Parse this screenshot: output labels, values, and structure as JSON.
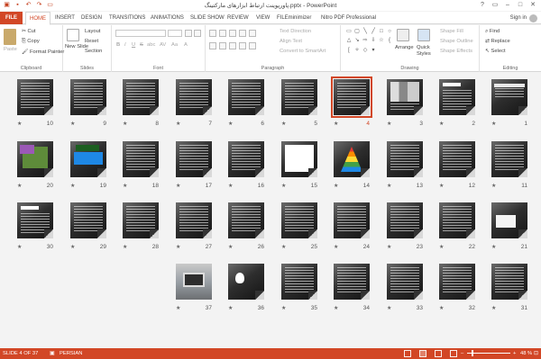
{
  "window": {
    "title": "پاورپوینت ارتباط ابزارهای مارکتینگ.pptx - PowerPoint",
    "qat_icons": [
      "save-icon",
      "undo-icon",
      "redo-icon",
      "start-presentation-icon"
    ],
    "controls": [
      "?",
      "▭",
      "–",
      "□",
      "✕"
    ]
  },
  "ribbon_tabs": [
    "FILE",
    "HOME",
    "INSERT",
    "DESIGN",
    "TRANSITIONS",
    "ANIMATIONS",
    "SLIDE SHOW",
    "REVIEW",
    "VIEW",
    "FILEminimizer",
    "Nitro PDF Professional"
  ],
  "active_tab": "HOME",
  "sign_in": "Sign in",
  "clipboard": {
    "paste": "Paste",
    "cut": "Cut",
    "copy": "Copy",
    "format_painter": "Format Painter",
    "label": "Clipboard"
  },
  "slides_group": {
    "new_slide": "New Slide",
    "layout": "Layout",
    "reset": "Reset",
    "section": "Section",
    "label": "Slides"
  },
  "font_group": {
    "label": "Font",
    "bold": "B",
    "italic": "I",
    "underline": "U",
    "strike": "S",
    "shadow": "abc",
    "spacing": "AV",
    "case": "Aa",
    "color": "A"
  },
  "paragraph_group": {
    "text_direction": "Text Direction",
    "align_text": "Align Text",
    "smartart": "Convert to SmartArt",
    "label": "Paragraph"
  },
  "drawing_group": {
    "arrange": "Arrange",
    "quick_styles": "Quick Styles",
    "shape_fill": "Shape Fill",
    "shape_outline": "Shape Outline",
    "shape_effects": "Shape Effects",
    "label": "Drawing"
  },
  "editing_group": {
    "find": "Find",
    "replace": "Replace",
    "select": "Select",
    "label": "Editing"
  },
  "slides": [
    {
      "n": "1",
      "v": "title"
    },
    {
      "n": "2",
      "v": "banner"
    },
    {
      "n": "3",
      "v": "people"
    },
    {
      "n": "4",
      "v": "text",
      "selected": true
    },
    {
      "n": "5",
      "v": "text"
    },
    {
      "n": "6",
      "v": "text"
    },
    {
      "n": "7",
      "v": "text"
    },
    {
      "n": "8",
      "v": "text"
    },
    {
      "n": "9",
      "v": "text"
    },
    {
      "n": "10",
      "v": "text"
    },
    {
      "n": "11",
      "v": "text"
    },
    {
      "n": "12",
      "v": "text"
    },
    {
      "n": "13",
      "v": "text"
    },
    {
      "n": "14",
      "v": "pyr"
    },
    {
      "n": "15",
      "v": "chart"
    },
    {
      "n": "16",
      "v": "text"
    },
    {
      "n": "17",
      "v": "text"
    },
    {
      "n": "18",
      "v": "text"
    },
    {
      "n": "19",
      "v": "vid"
    },
    {
      "n": "20",
      "v": "boxes"
    },
    {
      "n": "21",
      "v": "white"
    },
    {
      "n": "22",
      "v": "text"
    },
    {
      "n": "23",
      "v": "text"
    },
    {
      "n": "24",
      "v": "text"
    },
    {
      "n": "25",
      "v": "text"
    },
    {
      "n": "26",
      "v": "text"
    },
    {
      "n": "27",
      "v": "text"
    },
    {
      "n": "28",
      "v": "text"
    },
    {
      "n": "29",
      "v": "text"
    },
    {
      "n": "30",
      "v": "banner"
    },
    {
      "n": "31",
      "v": "text"
    },
    {
      "n": "32",
      "v": "text"
    },
    {
      "n": "33",
      "v": "text"
    },
    {
      "n": "34",
      "v": "text"
    },
    {
      "n": "35",
      "v": "text"
    },
    {
      "n": "36",
      "v": "gear"
    },
    {
      "n": "37",
      "v": "photo"
    }
  ],
  "star": "★",
  "status": {
    "slide_pos": "SLIDE 4 OF 37",
    "language": "PERSIAN",
    "zoom": "48 %",
    "zoom_minus": "–",
    "zoom_plus": "+"
  },
  "accent_color": "#d24726"
}
